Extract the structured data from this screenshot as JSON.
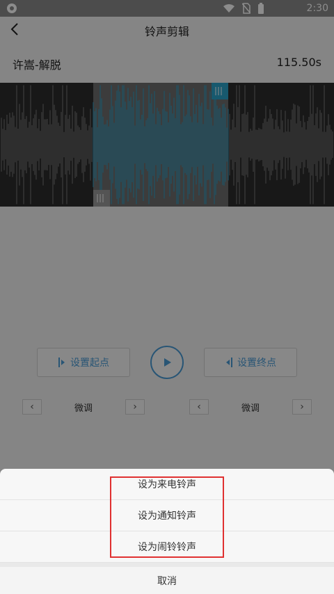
{
  "status": {
    "time": "2:30"
  },
  "header": {
    "title": "铃声剪辑"
  },
  "song": {
    "name": "许嵩-解脱",
    "duration": "115.50s"
  },
  "controls": {
    "start_label": "设置起点",
    "end_label": "设置终点",
    "fine_tune_left": "微调",
    "fine_tune_right": "微调"
  },
  "sheet": {
    "items": [
      "设为来电铃声",
      "设为通知铃声",
      "设为闹铃铃声"
    ],
    "cancel": "取消"
  },
  "colors": {
    "accent": "#4a9bd6",
    "waveform_selected": "#2aa3c8",
    "highlight": "#e03030"
  }
}
